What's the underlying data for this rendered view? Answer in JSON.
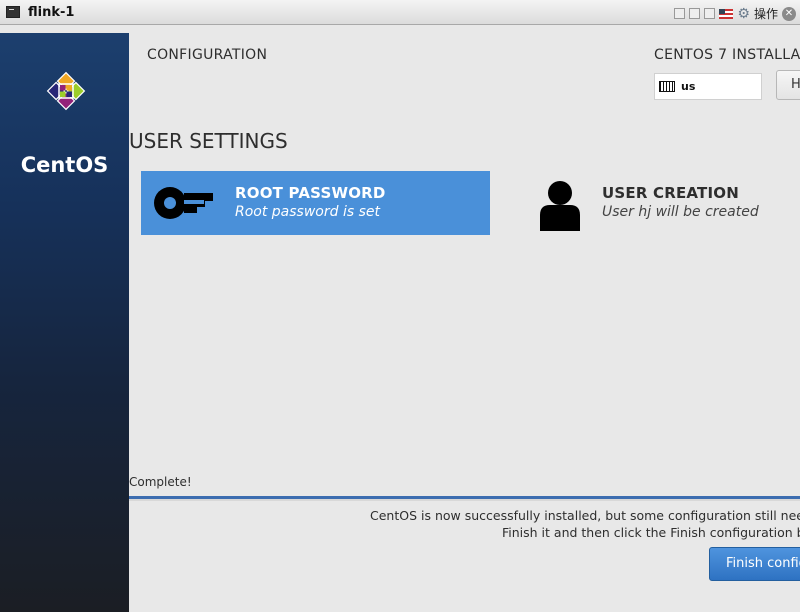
{
  "window": {
    "title": "flink-1",
    "ops_label": "操作",
    "icons": [
      "window-icon",
      "minimize-icon",
      "restore-icon",
      "maximize-icon",
      "us-flag-icon",
      "gear-icon",
      "close-icon"
    ]
  },
  "sidebar": {
    "logo_text": "CentOS"
  },
  "header": {
    "config_title": "CONFIGURATION",
    "install_title": "CENTOS 7 INSTALLA",
    "keyboard_layout": "us",
    "help_label": "H"
  },
  "user_settings": {
    "title": "USER SETTINGS",
    "root_password": {
      "title": "ROOT PASSWORD",
      "status": "Root password is set",
      "icon": "key-icon"
    },
    "user_creation": {
      "title": "USER CREATION",
      "status": "User hj will be created",
      "icon": "user-icon"
    }
  },
  "footer": {
    "progress_label": "Complete!",
    "progress": 1.0,
    "message_line1": "CentOS is now successfully installed, but some configuration still needs to",
    "message_line2": "Finish it and then click the Finish configuration butt",
    "finish_button": "Finish config"
  },
  "colors": {
    "selected_spoke": "#4a90d9",
    "progress_bar": "#3c6db0",
    "finish_button": "#3a82cf",
    "sidebar_top": "#1c3f6e",
    "background": "#e8e8e8"
  }
}
